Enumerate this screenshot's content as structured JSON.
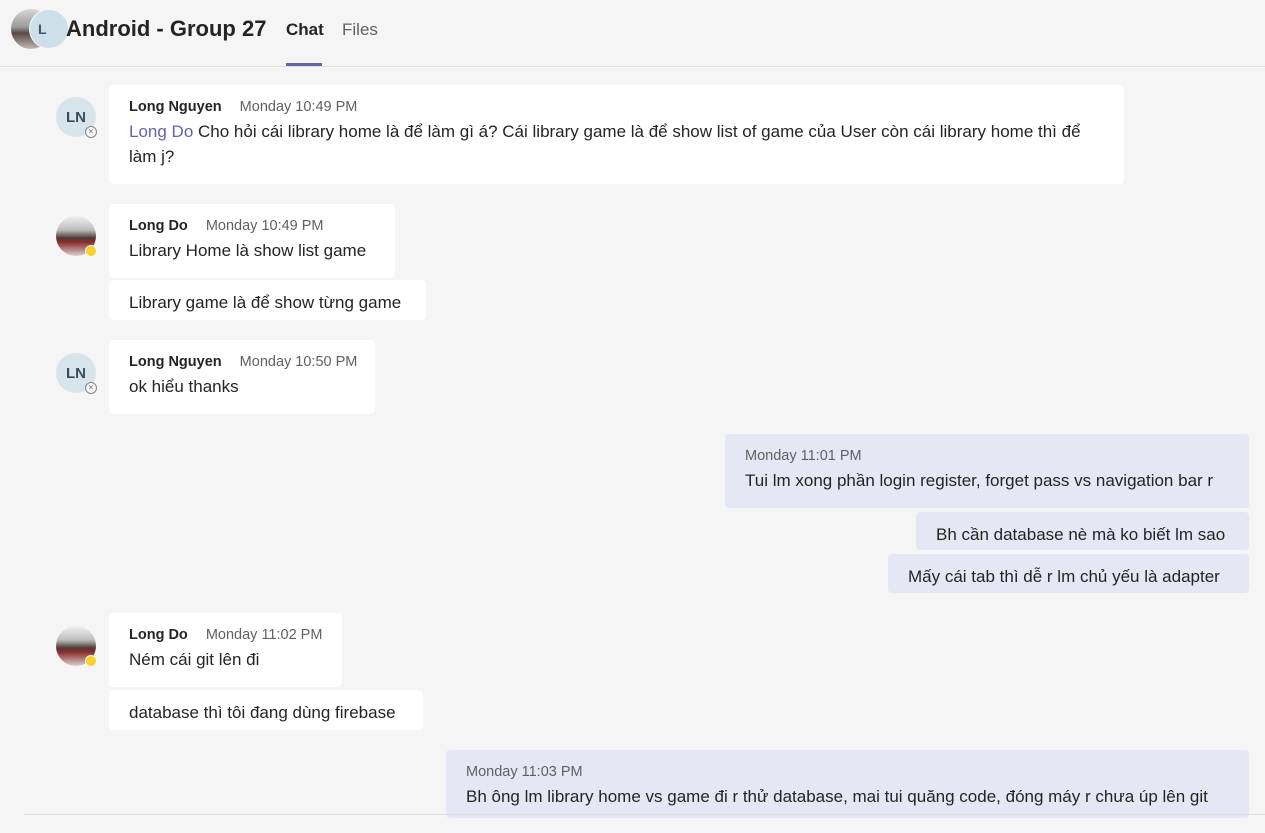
{
  "header": {
    "group_avatar_letter": "L",
    "title": "Android - Group 27",
    "tabs": [
      {
        "label": "Chat",
        "active": true
      },
      {
        "label": "Files",
        "active": false
      }
    ]
  },
  "messages": [
    {
      "author": "Long Nguyen",
      "initials": "LN",
      "time": "Monday 10:49 PM",
      "mention": "Long Do",
      "text": "Cho hỏi cái library home là để làm gì á? Cái library game là để show list of game của User còn cái library home thì để làm j?"
    },
    {
      "author": "Long Do",
      "time": "Monday 10:49 PM",
      "text": "Library Home  là show list game",
      "followup": "Library game là để show từng game"
    },
    {
      "author": "Long Nguyen",
      "initials": "LN",
      "time": "Monday 10:50 PM",
      "text": "ok hiểu thanks"
    },
    {
      "mine": true,
      "time": "Monday 11:01 PM",
      "text": "Tui lm xong phần login register, forget pass vs navigation bar r",
      "followups": [
        "Bh cần database nè mà ko biết lm sao",
        "Mấy cái tab thì dễ r lm chủ yếu là adapter"
      ]
    },
    {
      "author": "Long Do",
      "time": "Monday 11:02 PM",
      "text": "Ném cái git lên đi",
      "followup": "database thì tôi đang dùng firebase"
    },
    {
      "mine": true,
      "time": "Monday 11:03 PM",
      "text": "Bh ông lm library home vs game đi r thử database, mai tui quăng code, đóng máy r chưa úp lên git"
    }
  ],
  "colors": {
    "accent": "#6264a7",
    "background": "#f5f5f5",
    "own_bubble": "#e6e7f5",
    "other_bubble": "#ffffff",
    "away_status": "#f8d22a"
  },
  "icons": {
    "offline_status": "offline-status-icon",
    "away_status": "away-status-icon"
  }
}
